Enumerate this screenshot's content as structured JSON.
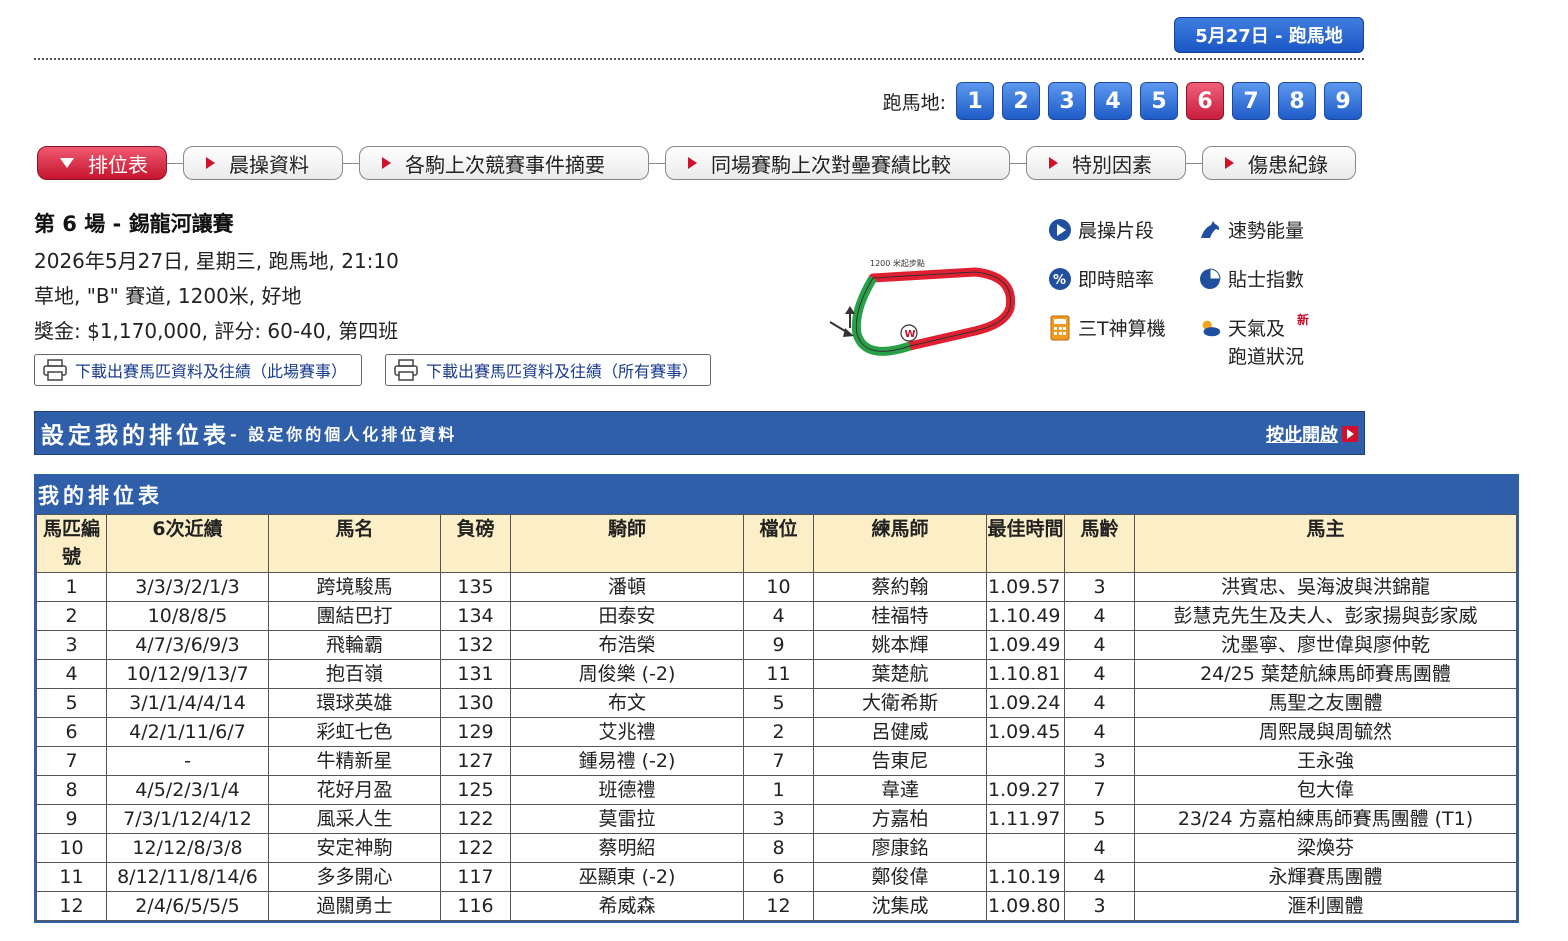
{
  "header": {
    "date_button": "5月27日 - 跑馬地",
    "race_label": "跑馬地:",
    "race_numbers": [
      "1",
      "2",
      "3",
      "4",
      "5",
      "6",
      "7",
      "8",
      "9"
    ],
    "active_race": "6"
  },
  "tabs": [
    {
      "label": "排位表",
      "active": true
    },
    {
      "label": "晨操資料",
      "active": false
    },
    {
      "label": "各駒上次競賽事件摘要",
      "active": false
    },
    {
      "label": "同場賽駒上次對壘賽績比較",
      "active": false
    },
    {
      "label": "特別因素",
      "active": false
    },
    {
      "label": "傷患紀錄",
      "active": false
    }
  ],
  "race": {
    "title": "第 6 場 - 錫龍河讓賽",
    "line1": "2026年5月27日, 星期三, 跑馬地, 21:10",
    "line2": "草地, \"B\" 賽道, 1200米, 好地",
    "line3": "獎金: $1,170,000, 評分: 60-40, 第四班",
    "download_this": "下載出賽馬匹資料及往績（此場賽事）",
    "download_all": "下載出賽馬匹資料及往績（所有賽事）",
    "track_label": "1200 米起步點"
  },
  "tools": {
    "trackwork_video": "晨操片段",
    "speed_pro": "速勢能量",
    "live_odds": "即時賠率",
    "tips_index": "貼士指數",
    "calculator": "三T神算機",
    "weather_line1": "天氣及",
    "weather_line2": "跑道狀況",
    "new_badge": "新"
  },
  "config": {
    "title": "設定我的排位表",
    "subtitle": "- 設定你的個人化排位資料",
    "open_link": "按此開啟"
  },
  "table": {
    "title": "我的排位表",
    "headers": [
      "馬匹編號",
      "6次近績",
      "馬名",
      "負磅",
      "騎師",
      "檔位",
      "練馬師",
      "最佳時間",
      "馬齡",
      "馬主"
    ],
    "rows": [
      [
        "1",
        "3/3/3/2/1/3",
        "跨境駿馬",
        "135",
        "潘頓",
        "10",
        "蔡約翰",
        "1.09.57",
        "3",
        "洪賓忠、吳海波與洪錦龍"
      ],
      [
        "2",
        "10/8/8/5",
        "團結巴打",
        "134",
        "田泰安",
        "4",
        "桂福特",
        "1.10.49",
        "4",
        "彭慧克先生及夫人、彭家揚與彭家威"
      ],
      [
        "3",
        "4/7/3/6/9/3",
        "飛輪霸",
        "132",
        "布浩榮",
        "9",
        "姚本輝",
        "1.09.49",
        "4",
        "沈墨寧、廖世偉與廖仲乾"
      ],
      [
        "4",
        "10/12/9/13/7",
        "抱百嶺",
        "131",
        "周俊樂 (-2)",
        "11",
        "葉楚航",
        "1.10.81",
        "4",
        "24/25 葉楚航練馬師賽馬團體"
      ],
      [
        "5",
        "3/1/1/4/4/14",
        "環球英雄",
        "130",
        "布文",
        "5",
        "大衛希斯",
        "1.09.24",
        "4",
        "馬聖之友團體"
      ],
      [
        "6",
        "4/2/1/11/6/7",
        "彩虹七色",
        "129",
        "艾兆禮",
        "2",
        "呂健威",
        "1.09.45",
        "4",
        "周熙晟與周毓然"
      ],
      [
        "7",
        "-",
        "牛精新星",
        "127",
        "鍾易禮 (-2)",
        "7",
        "告東尼",
        "",
        "3",
        "王永強"
      ],
      [
        "8",
        "4/5/2/3/1/4",
        "花好月盈",
        "125",
        "班德禮",
        "1",
        "韋達",
        "1.09.27",
        "7",
        "包大偉"
      ],
      [
        "9",
        "7/3/1/12/4/12",
        "風采人生",
        "122",
        "莫雷拉",
        "3",
        "方嘉柏",
        "1.11.97",
        "5",
        "23/24 方嘉柏練馬師賽馬團體 (T1)"
      ],
      [
        "10",
        "12/12/8/3/8",
        "安定神駒",
        "122",
        "蔡明紹",
        "8",
        "廖康銘",
        "",
        "4",
        "梁煥芬"
      ],
      [
        "11",
        "8/12/11/8/14/6",
        "多多開心",
        "117",
        "巫顯東 (-2)",
        "6",
        "鄭俊偉",
        "1.10.19",
        "4",
        "永輝賽馬團體"
      ],
      [
        "12",
        "2/4/6/5/5/5",
        "過關勇士",
        "116",
        "希威森",
        "12",
        "沈集成",
        "1.09.80",
        "3",
        "滙利團體"
      ]
    ]
  },
  "colors": {
    "primary_blue": "#2e5fa8",
    "accent_red": "#c8102e",
    "header_cream": "#fcefc8",
    "track_red": "#e02030",
    "track_green": "#28a048"
  }
}
